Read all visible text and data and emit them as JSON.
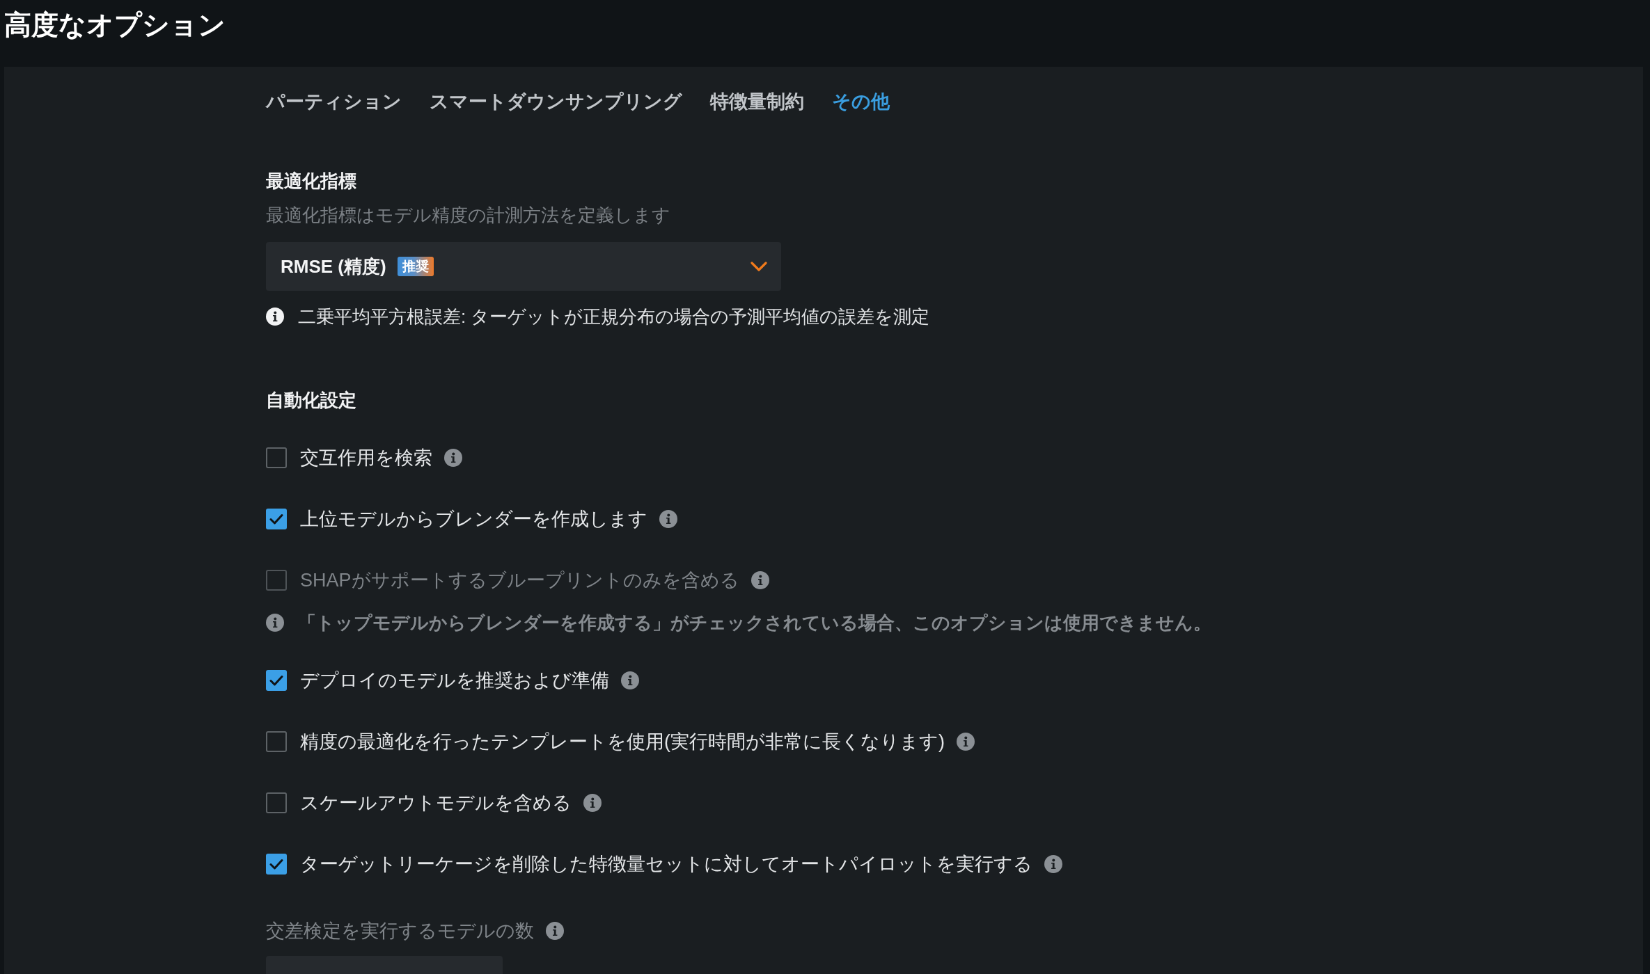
{
  "title": "高度なオプション",
  "tabs": [
    {
      "label": "パーティション",
      "selected": false
    },
    {
      "label": "スマートダウンサンプリング",
      "selected": false
    },
    {
      "label": "特徴量制約",
      "selected": false
    },
    {
      "label": "その他",
      "selected": true
    }
  ],
  "metric": {
    "heading": "最適化指標",
    "description": "最適化指標はモデル精度の計測方法を定義します",
    "select": {
      "value": "RMSE (精度)",
      "badge": "推奨"
    },
    "info": "二乗平均平方根誤差: ターゲットが正規分布の場合の予測平均値の誤差を測定"
  },
  "automation": {
    "heading": "自動化設定",
    "options": [
      {
        "label": "交互作用を検索",
        "checked": false,
        "disabled": false
      },
      {
        "label": "上位モデルからブレンダーを作成します",
        "checked": true,
        "disabled": false
      },
      {
        "label": "SHAPがサポートするブループリントのみを含める",
        "checked": false,
        "disabled": true,
        "note": "「トップモデルからブレンダーを作成する」がチェックされている場合、このオプションは使用できません。"
      },
      {
        "label": "デプロイのモデルを推奨および準備",
        "checked": true,
        "disabled": false
      },
      {
        "label": "精度の最適化を行ったテンプレートを使用(実行時間が非常に長くなります)",
        "checked": false,
        "disabled": false
      },
      {
        "label": "スケールアウトモデルを含める",
        "checked": false,
        "disabled": false
      },
      {
        "label": "ターゲットリーケージを削除した特徴量セットに対してオートパイロットを実行する",
        "checked": true,
        "disabled": false
      }
    ]
  },
  "cv_models": {
    "label": "交差検定を実行するモデルの数",
    "disabled": true
  }
}
